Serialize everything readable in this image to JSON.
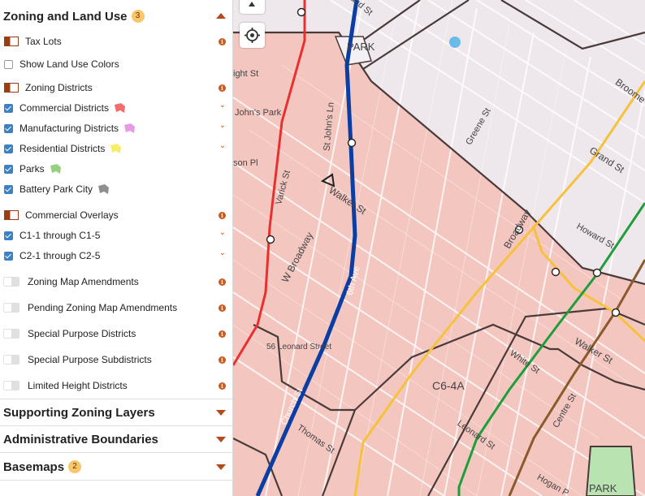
{
  "panel": {
    "section_zoning": {
      "title": "Zoning and Land Use",
      "count": "3"
    },
    "tax_lots": "Tax Lots",
    "show_land_use_colors": "Show Land Use Colors",
    "zoning_districts": "Zoning Districts",
    "district_items": [
      {
        "label": "Commercial Districts",
        "checked": true,
        "color": "#f26d6d"
      },
      {
        "label": "Manufacturing Districts",
        "checked": true,
        "color": "#e79be6"
      },
      {
        "label": "Residential Districts",
        "checked": true,
        "color": "#f5ee6a"
      },
      {
        "label": "Parks",
        "checked": true,
        "color": "#97d07f"
      },
      {
        "label": "Battery Park City",
        "checked": true,
        "color": "#8f8f8f"
      }
    ],
    "commercial_overlays": "Commercial Overlays",
    "overlay_items": [
      {
        "label": "C1-1 through C1-5",
        "checked": true
      },
      {
        "label": "C2-1 through C2-5",
        "checked": true
      }
    ],
    "toggle_layers": [
      "Zoning Map Amendments",
      "Pending Zoning Map Amendments",
      "Special Purpose Districts",
      "Special Purpose Subdistricts",
      "Limited Height Districts"
    ],
    "collapsed_sections": [
      {
        "title": "Supporting Zoning Layers",
        "count": ""
      },
      {
        "title": "Administrative Boundaries",
        "count": ""
      },
      {
        "title": "Basemaps",
        "count": "2"
      }
    ],
    "info_glyph": "i",
    "chevron_glyph": "⌄"
  },
  "map": {
    "labels": {
      "park_top": "PARK",
      "park_bottom": "PARK",
      "grand_st_top": "Grand St",
      "grand_st": "Grand St",
      "broome": "Broome",
      "greene_st": "Greene St",
      "howard_st": "Howard St",
      "walker_st": "Walker St",
      "walker_st_right": "Walker St",
      "white_st": "White St",
      "centre_st": "Centre St",
      "broadway": "Broadway",
      "w_broadway": "W Broadway",
      "sixth_ave": "6th Ave",
      "varick_st": "Varick St",
      "st_johns_ln": "St John's Ln",
      "johns_park": "John's Park",
      "ight_st": "ight St",
      "son_pl": "son Pl",
      "leonard_56": "56 Leonard Street",
      "leonard_st": "Leonard St",
      "thomas_st": "Thomas St",
      "church_st": "Church St",
      "hogan": "Hogan P",
      "zone_c64a": "C6-4A"
    },
    "colors": {
      "commercial_fill": "#f4c6c0",
      "background": "#eee8ec",
      "red_line": "#e8302f",
      "blue_line": "#0b3ea3",
      "yellow_line": "#f6c23b",
      "green_line": "#1e9e3b",
      "brown_line": "#8a5a2c",
      "zoning_border": "#4a3b3b"
    }
  }
}
